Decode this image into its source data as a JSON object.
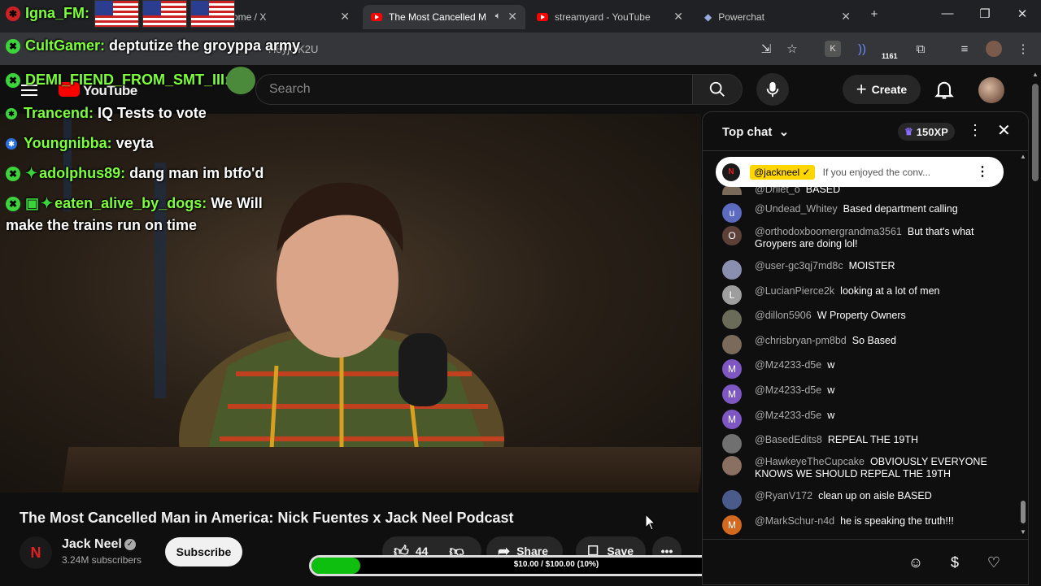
{
  "browser": {
    "tabs": [
      {
        "label": "ome / X"
      },
      {
        "label": "The Most Cancelled M"
      },
      {
        "label": "streamyard - YouTube"
      },
      {
        "label": "Powerchat"
      }
    ],
    "url": "H8yjGK2U",
    "extension_badge": "1161"
  },
  "yt": {
    "logo": "YouTube",
    "search_placeholder": "Search",
    "create_label": "Create"
  },
  "overlay_chat": [
    {
      "name": "Igna_FM:",
      "text": ""
    },
    {
      "name": "CultGamer:",
      "text": "deptutize the groyppa army"
    },
    {
      "name": "DEMI_FIEND_FROM_SMT_III:",
      "text": ""
    },
    {
      "name": "Trancend:",
      "text": "IQ Tests to vote"
    },
    {
      "name": "Youngnibba:",
      "text": "veyta"
    },
    {
      "name": "adolphus89:",
      "text": "dang man im btfo'd"
    },
    {
      "name": "eaten_alive_by_dogs:",
      "text": "We Will"
    },
    {
      "name": "",
      "text": "make the trains run on time"
    }
  ],
  "video": {
    "title": "The Most Cancelled Man in America: Nick Fuentes x Jack Neel Podcast",
    "channel": "Jack Neel",
    "subscribers": "3.24M subscribers",
    "subscribe_label": "Subscribe",
    "likes": "44",
    "share_label": "Share",
    "save_label": "Save"
  },
  "donation": {
    "text": "$10.00 / $100.00 (10%)",
    "progress_fraction": 0.1
  },
  "chat": {
    "header": "Top chat",
    "xp": "150XP",
    "pinned_author": "@jackneel",
    "pinned_text": "If you enjoyed the conv...",
    "partial_author": "@Drilet_o",
    "partial_text": "BASED",
    "messages": [
      {
        "author": "@Undead_Whitey",
        "text": "Based department calling",
        "avatar": "u",
        "color": "#5c6bc0"
      },
      {
        "author": "@orthodoxboomergrandma3561",
        "text": "But that's what Groypers are doing lol!",
        "avatar": "O",
        "color": "#5d4037"
      },
      {
        "author": "@user-gc3qj7md8c",
        "text": "MOISTER",
        "avatar": "",
        "color": "#8a8fb0"
      },
      {
        "author": "@LucianPierce2k",
        "text": "looking at a lot of men",
        "avatar": "L",
        "color": "#9e9e9e"
      },
      {
        "author": "@dillon5906",
        "text": "W Property Owners",
        "avatar": "",
        "color": "#6b6b5a"
      },
      {
        "author": "@chrisbryan-pm8bd",
        "text": "So Based",
        "avatar": "",
        "color": "#7a6a5a"
      },
      {
        "author": "@Mz4233-d5e",
        "text": "w",
        "avatar": "M",
        "color": "#7e57c2"
      },
      {
        "author": "@Mz4233-d5e",
        "text": "w",
        "avatar": "M",
        "color": "#7e57c2"
      },
      {
        "author": "@Mz4233-d5e",
        "text": "w",
        "avatar": "M",
        "color": "#7e57c2"
      },
      {
        "author": "@BasedEdits8",
        "text": "REPEAL THE 19TH",
        "avatar": "",
        "color": "#707070"
      },
      {
        "author": "@HawkeyeTheCupcake",
        "text": "OBVIOUSLY EVERYONE KNOWS WE SHOULD REPEAL THE 19TH",
        "avatar": "",
        "color": "#8a7060"
      },
      {
        "author": "@RyanV172",
        "text": "clean up on aisle BASED",
        "avatar": "",
        "color": "#4a5a8a"
      },
      {
        "author": "@MarkSchur-n4d",
        "text": "he is speaking the truth!!!",
        "avatar": "M",
        "color": "#d2691e"
      }
    ]
  }
}
